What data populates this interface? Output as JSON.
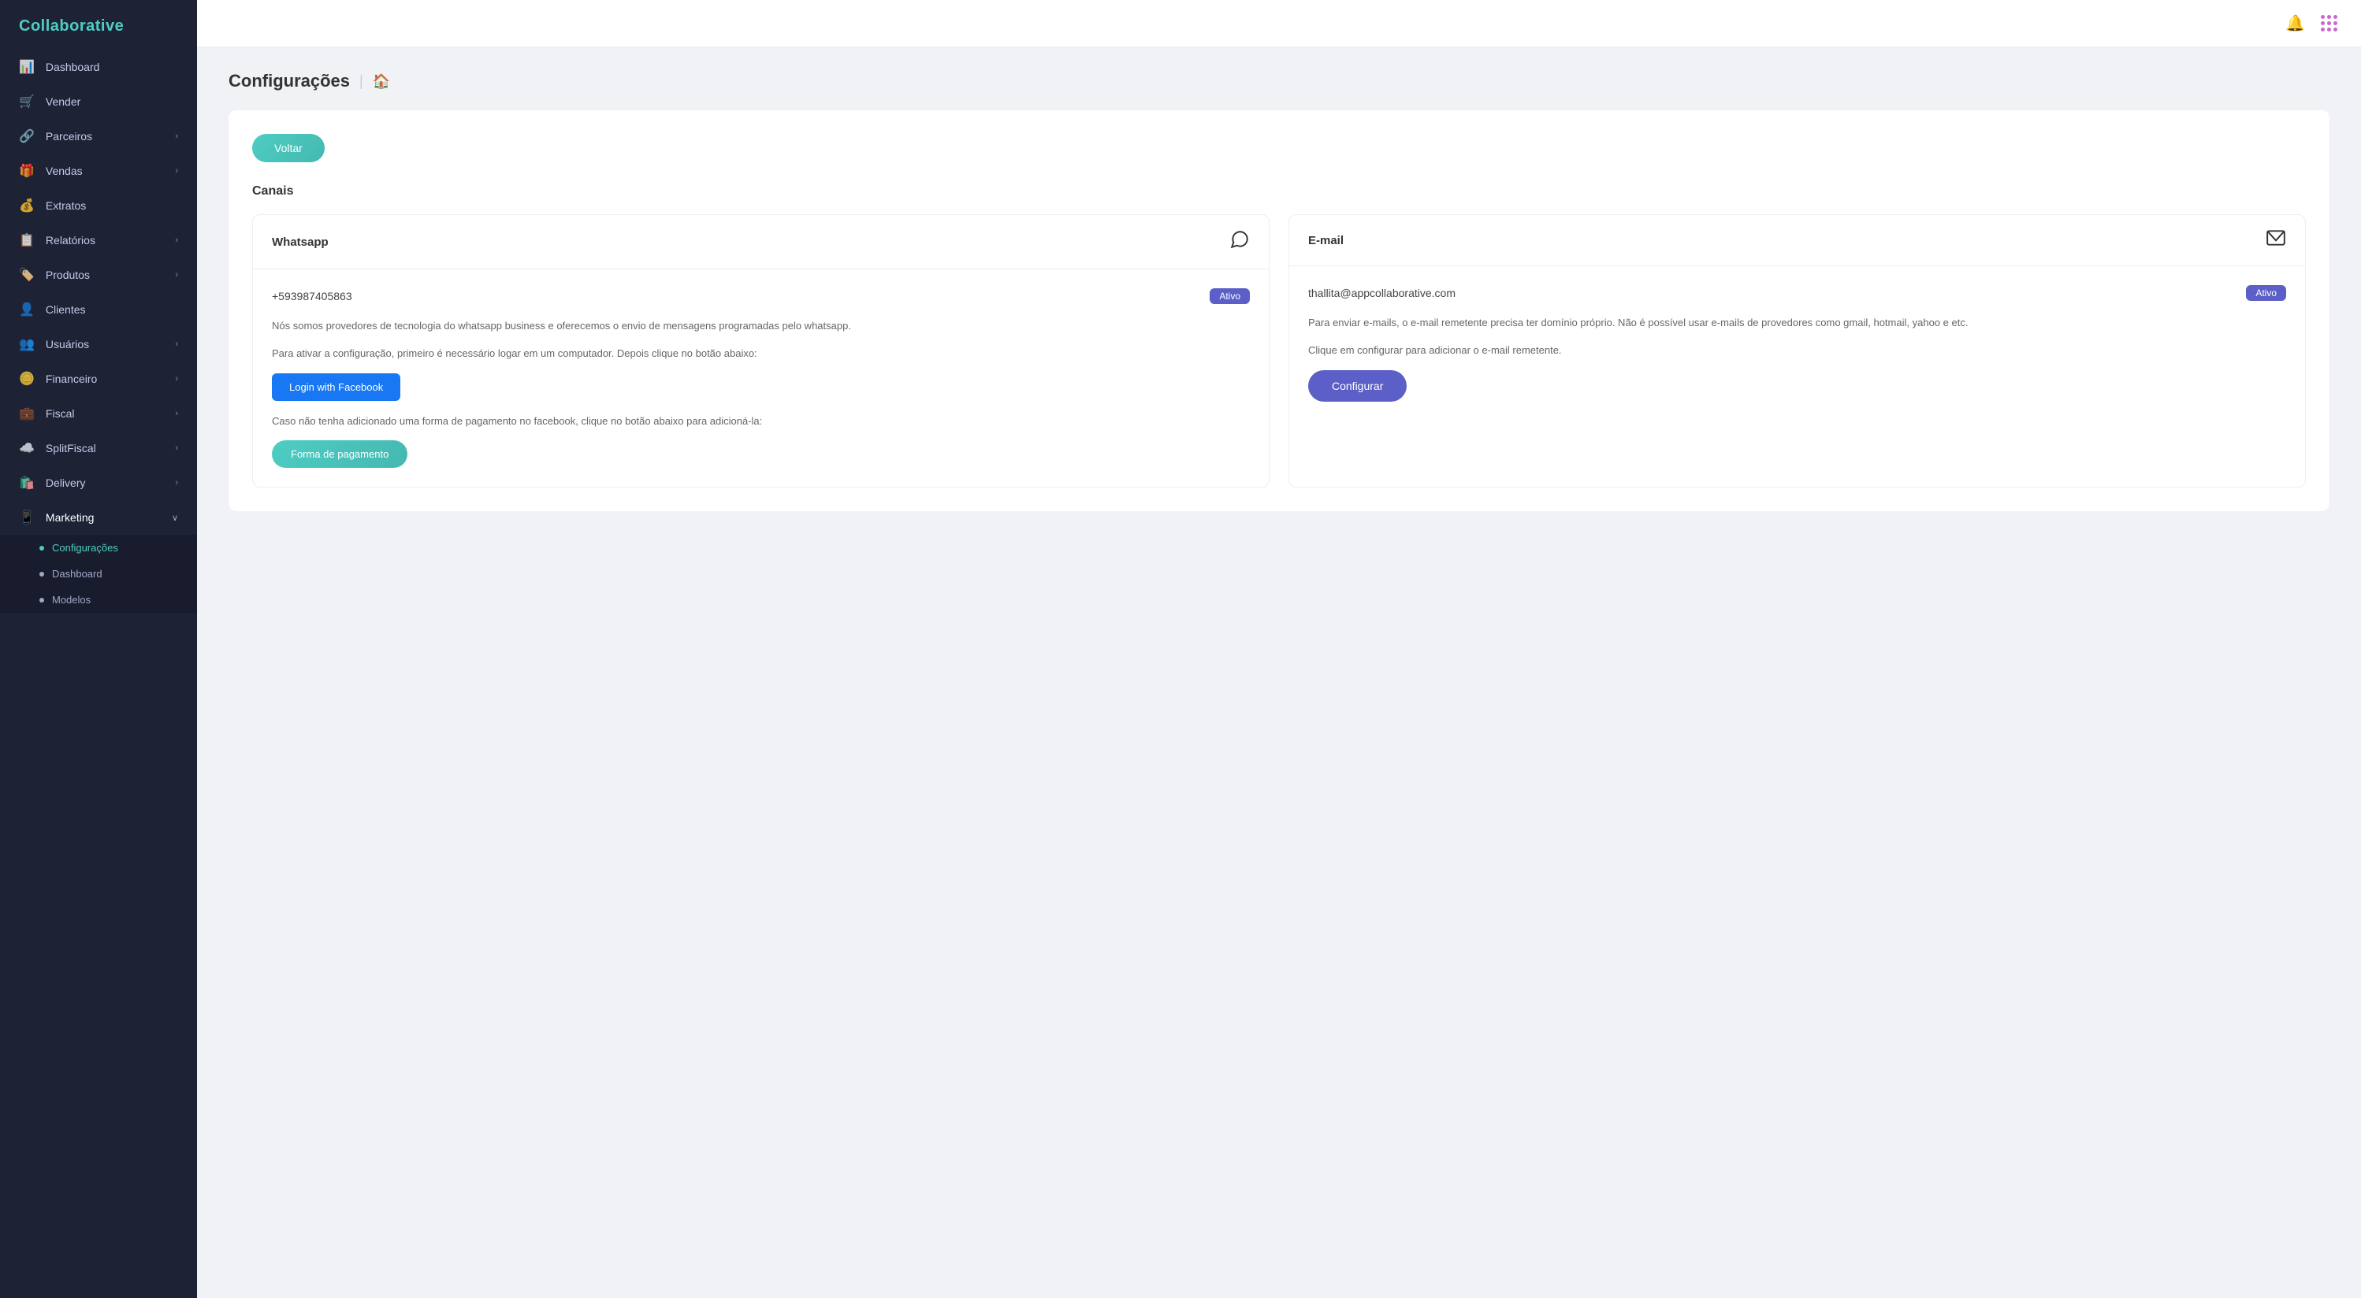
{
  "app": {
    "name": "Collaborative"
  },
  "sidebar": {
    "logo": "Collaborative",
    "items": [
      {
        "id": "dashboard",
        "label": "Dashboard",
        "icon": "📊",
        "arrow": false
      },
      {
        "id": "vender",
        "label": "Vender",
        "icon": "🛒",
        "arrow": false
      },
      {
        "id": "parceiros",
        "label": "Parceiros",
        "icon": "🔗",
        "arrow": true
      },
      {
        "id": "vendas",
        "label": "Vendas",
        "icon": "🎁",
        "arrow": true
      },
      {
        "id": "extratos",
        "label": "Extratos",
        "icon": "💰",
        "arrow": false
      },
      {
        "id": "relatorios",
        "label": "Relatórios",
        "icon": "📋",
        "arrow": true
      },
      {
        "id": "produtos",
        "label": "Produtos",
        "icon": "🏷️",
        "arrow": true
      },
      {
        "id": "clientes",
        "label": "Clientes",
        "icon": "👤",
        "arrow": false
      },
      {
        "id": "usuarios",
        "label": "Usuários",
        "icon": "👥",
        "arrow": true
      },
      {
        "id": "financeiro",
        "label": "Financeiro",
        "icon": "🪙",
        "arrow": true
      },
      {
        "id": "fiscal",
        "label": "Fiscal",
        "icon": "💼",
        "arrow": true
      },
      {
        "id": "splitfiscal",
        "label": "SplitFiscal",
        "icon": "☁️",
        "arrow": true
      },
      {
        "id": "delivery",
        "label": "Delivery",
        "icon": "🛍️",
        "arrow": true
      },
      {
        "id": "marketing",
        "label": "Marketing",
        "icon": "📱",
        "arrow": true,
        "expanded": true
      }
    ],
    "sub_items": [
      {
        "id": "configuracoes",
        "label": "Configurações",
        "active": true
      },
      {
        "id": "dashboard-sub",
        "label": "Dashboard",
        "active": false
      },
      {
        "id": "modelos",
        "label": "Modelos",
        "active": false
      }
    ]
  },
  "breadcrumb": {
    "title": "Configurações",
    "home_icon": "🏠"
  },
  "page": {
    "back_button": "Voltar",
    "section_title": "Canais",
    "whatsapp_card": {
      "title": "Whatsapp",
      "phone": "+593987405863",
      "badge": "Ativo",
      "desc1": "Nós somos provedores de tecnologia do whatsapp business e oferecemos o envio de mensagens programadas pelo whatsapp.",
      "desc2": "Para ativar a configuração, primeiro é necessário logar em um computador. Depois clique no botão abaixo:",
      "login_btn": "Login with Facebook",
      "desc3": "Caso não tenha adicionado uma forma de pagamento no facebook, clique no botão abaixo para adicioná-la:",
      "payment_btn": "Forma de pagamento"
    },
    "email_card": {
      "title": "E-mail",
      "email": "thallita@appcollaborative.com",
      "badge": "Ativo",
      "desc1": "Para enviar e-mails, o e-mail remetente precisa ter domínio próprio. Não é possível usar e-mails de provedores como gmail, hotmail, yahoo e etc.",
      "desc2": "Clique em configurar para adicionar o e-mail remetente.",
      "configure_btn": "Configurar"
    }
  }
}
